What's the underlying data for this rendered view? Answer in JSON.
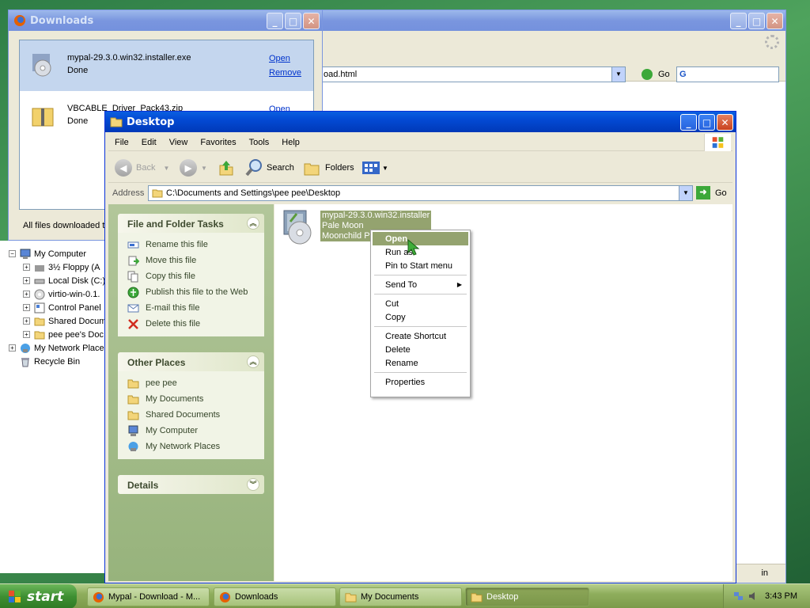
{
  "browser": {
    "url_visible": "oad.html",
    "go_label": "Go",
    "search_logo": "G",
    "status_text": "in"
  },
  "downloads": {
    "title": "Downloads",
    "items": [
      {
        "name": "mypal-29.3.0.win32.installer.exe",
        "status": "Done",
        "open": "Open",
        "remove": "Remove"
      },
      {
        "name": "VBCABLE_Driver_Pack43.zip",
        "status": "Done",
        "open": "Open"
      }
    ],
    "status_bar": "All files downloaded t"
  },
  "tree": {
    "items": [
      {
        "label": "My Computer",
        "indent": 0,
        "expander": "−",
        "icon": "computer-icon"
      },
      {
        "label": "3½ Floppy (A",
        "indent": 1,
        "expander": "+",
        "icon": "floppy-icon"
      },
      {
        "label": "Local Disk (C:)",
        "indent": 1,
        "expander": "+",
        "icon": "disk-icon"
      },
      {
        "label": "virtio-win-0.1.",
        "indent": 1,
        "expander": "+",
        "icon": "cd-icon"
      },
      {
        "label": "Control Panel",
        "indent": 1,
        "expander": "+",
        "icon": "control-panel-icon"
      },
      {
        "label": "Shared Docum",
        "indent": 1,
        "expander": "+",
        "icon": "folder-icon"
      },
      {
        "label": "pee pee's Doc",
        "indent": 1,
        "expander": "+",
        "icon": "folder-icon"
      },
      {
        "label": "My Network Place",
        "indent": 0,
        "expander": "+",
        "icon": "network-icon"
      },
      {
        "label": "Recycle Bin",
        "indent": 0,
        "expander": "",
        "icon": "recycle-bin-icon"
      }
    ]
  },
  "explorer": {
    "title": "Desktop",
    "menu": [
      "File",
      "Edit",
      "View",
      "Favorites",
      "Tools",
      "Help"
    ],
    "toolbar": {
      "back": "Back",
      "search": "Search",
      "folders": "Folders"
    },
    "address_label": "Address",
    "address_value": "C:\\Documents and Settings\\pee pee\\Desktop",
    "go_label": "Go",
    "file_tasks": {
      "title": "File and Folder Tasks",
      "items": [
        "Rename this file",
        "Move this file",
        "Copy this file",
        "Publish this file to the Web",
        "E-mail this file",
        "Delete this file"
      ]
    },
    "other_places": {
      "title": "Other Places",
      "items": [
        "pee pee",
        "My Documents",
        "Shared Documents",
        "My Computer",
        "My Network Places"
      ]
    },
    "details": {
      "title": "Details"
    },
    "file": {
      "line1": "mypal-29.3.0.win32.installer",
      "line2": "Pale Moon",
      "line3": "Moonchild Pro"
    }
  },
  "context_menu": {
    "group1": [
      "Open",
      "Run as...",
      "Pin to Start menu"
    ],
    "send_to": "Send To",
    "group3": [
      "Cut",
      "Copy"
    ],
    "group4": [
      "Create Shortcut",
      "Delete",
      "Rename"
    ],
    "properties": "Properties",
    "run_as_visible": "Run as"
  },
  "taskbar": {
    "start": "start",
    "tasks": [
      "Mypal - Download - M...",
      "Downloads",
      "My Documents",
      "Desktop"
    ],
    "clock": "3:43 PM"
  },
  "colors": {
    "xp_blue": "#0349d3",
    "olive_highlight": "#94a36f",
    "taskbar_green": "#8fae5d"
  }
}
